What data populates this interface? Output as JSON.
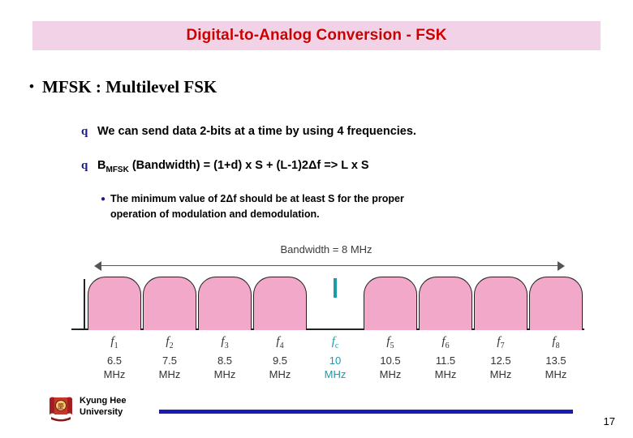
{
  "slide": {
    "title": "Digital-to-Analog Conversion - FSK",
    "title_bg": "#f2d2e6",
    "title_color": "#cc0000",
    "bullet1": {
      "marker": "•",
      "text": "MFSK  : Multilevel  FSK"
    },
    "bullets2": [
      {
        "marker": "q",
        "text": "We can send data 2-bits at a time by using 4 frequencies."
      },
      {
        "marker": "q",
        "text_pre": "B",
        "text_sub": "MFSK",
        "text_post": " (Bandwidth) = (1+d) x S + (L-1)2Δf  =>  L x S"
      }
    ],
    "bullet3": {
      "marker": "●",
      "line1": "The minimum value of 2Δf should be at least S for the proper",
      "line2": "operation of modulation and demodulation."
    },
    "figure": {
      "bandwidth_label": "Bandwidth = 8 MHz",
      "band_color": "#f2a8c8",
      "carrier_color": "#1b9aa8",
      "bands": [
        {
          "name": "f",
          "index": "1",
          "value": "6.5",
          "unit": "MHz",
          "carrier": false
        },
        {
          "name": "f",
          "index": "2",
          "value": "7.5",
          "unit": "MHz",
          "carrier": false
        },
        {
          "name": "f",
          "index": "3",
          "value": "8.5",
          "unit": "MHz",
          "carrier": false
        },
        {
          "name": "f",
          "index": "4",
          "value": "9.5",
          "unit": "MHz",
          "carrier": false
        },
        {
          "name": "f",
          "index": "c",
          "value": "10",
          "unit": "MHz",
          "carrier": true
        },
        {
          "name": "f",
          "index": "5",
          "value": "10.5",
          "unit": "MHz",
          "carrier": false
        },
        {
          "name": "f",
          "index": "6",
          "value": "11.5",
          "unit": "MHz",
          "carrier": false
        },
        {
          "name": "f",
          "index": "7",
          "value": "12.5",
          "unit": "MHz",
          "carrier": false
        },
        {
          "name": "f",
          "index": "8",
          "value": "13.5",
          "unit": "MHz",
          "carrier": false
        }
      ]
    },
    "footer": {
      "org_line1": "Kyung Hee",
      "org_line2": "University",
      "page_number": "17",
      "rule_color": "#1a1ab4"
    }
  }
}
